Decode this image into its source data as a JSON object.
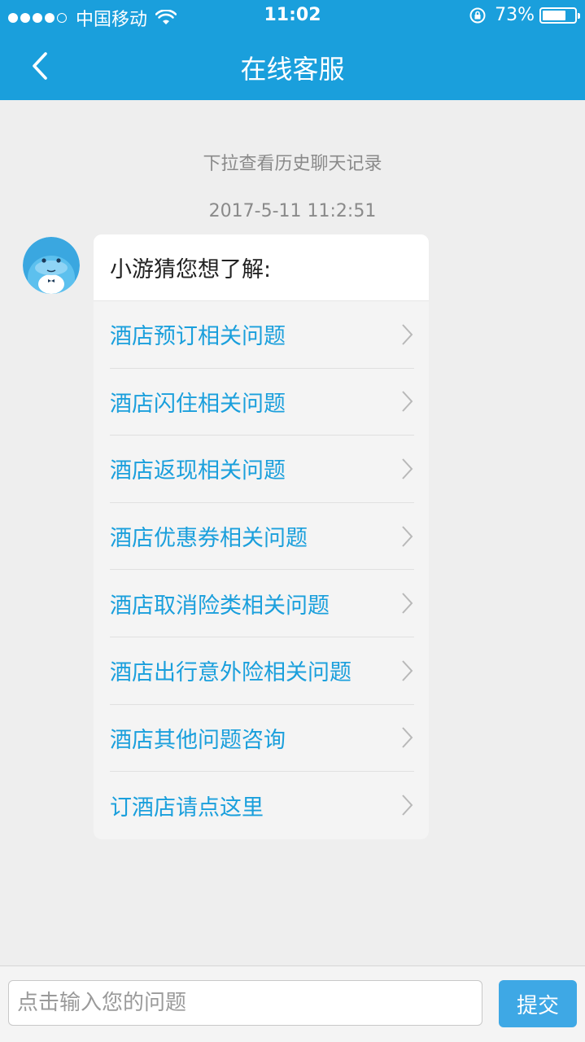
{
  "status_bar": {
    "carrier": "中国移动",
    "time": "11:02",
    "battery_percent": "73%",
    "battery_level": 0.73,
    "signal_bars_filled": 4,
    "signal_bars_total": 5
  },
  "nav": {
    "title": "在线客服",
    "back_icon": "chevron-left-icon"
  },
  "chat": {
    "history_hint": "下拉查看历史聊天记录",
    "timestamp": "2017-5-11 11:2:51",
    "message": {
      "greeting": "小游猜您想了解:",
      "options": [
        {
          "label": "酒店预订相关问题"
        },
        {
          "label": "酒店闪住相关问题"
        },
        {
          "label": "酒店返现相关问题"
        },
        {
          "label": "酒店优惠券相关问题"
        },
        {
          "label": "酒店取消险类相关问题"
        },
        {
          "label": "酒店出行意外险相关问题"
        },
        {
          "label": "酒店其他问题咨询"
        },
        {
          "label": "订酒店请点这里"
        }
      ]
    }
  },
  "input": {
    "placeholder": "点击输入您的问题",
    "value": "",
    "submit_label": "提交"
  },
  "colors": {
    "brand_blue": "#1a9fdc",
    "submit_blue": "#3ea8e5",
    "link_blue": "#1a9fdc"
  }
}
